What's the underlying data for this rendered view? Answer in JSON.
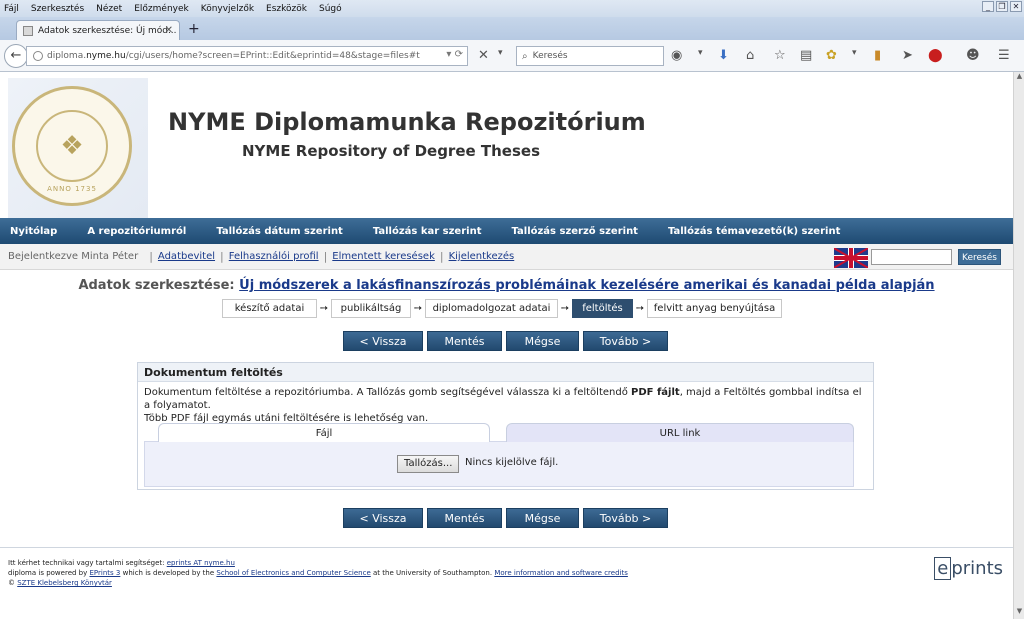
{
  "browser": {
    "menu": [
      "Fájl",
      "Szerkesztés",
      "Nézet",
      "Előzmények",
      "Könyvjelzők",
      "Eszközök",
      "Súgó"
    ],
    "tab_title": "Adatok szerkesztése: Új mód...",
    "url_prefix": "diploma.",
    "url_host": "nyme.hu",
    "url_rest": "/cgi/users/home?screen=EPrint::Edit&eprintid=48&stage=files#t",
    "search_placeholder": "Keresés"
  },
  "site": {
    "title": "NYME Diplomamunka Repozitórium",
    "subtitle": "NYME Repository of Degree Theses",
    "seal_text": "ANNO 1735"
  },
  "main_nav": [
    "Nyitólap",
    "A repozitóriumról",
    "Tallózás dátum szerint",
    "Tallózás kar szerint",
    "Tallózás szerző szerint",
    "Tallózás témavezető(k) szerint"
  ],
  "user_nav": {
    "logged_in": "Bejelentkezve Minta Péter",
    "links": [
      "Adatbevitel",
      "Felhasználói profil",
      "Elmentett keresések",
      "Kijelentkezés"
    ],
    "search_button": "Keresés"
  },
  "edit": {
    "label": "Adatok szerkesztése:",
    "item_title": "Új módszerek a lakásfinanszírozás problémáinak kezelésére amerikai és kanadai példa alapján"
  },
  "stages": [
    "készítő adatai",
    "publikáltság",
    "diplomadolgozat adatai",
    "feltöltés",
    "felvitt anyag benyújtása"
  ],
  "active_stage": "feltöltés",
  "buttons": {
    "back": "< Vissza",
    "save": "Mentés",
    "cancel": "Mégse",
    "next": "Tovább >"
  },
  "upload": {
    "heading": "Dokumentum feltöltés",
    "text_before": "Dokumentum feltöltése a repozitóriumba. A Tallózás gomb segítségével válassza ki a feltöltendő ",
    "text_bold": "PDF fájlt",
    "text_after": ", majd a Feltöltés gombbal indítsa el a folyamatot.",
    "text_line2": "Több PDF fájl egymás utáni feltöltésére is lehetőség van.",
    "tab_file": "Fájl",
    "tab_url": "URL link",
    "browse_button": "Tallózás...",
    "no_file": "Nincs kijelölve fájl."
  },
  "footer": {
    "help_text": "Itt kérhet technikai vagy tartalmi segítséget:",
    "help_email": "eprints AT nyme.hu",
    "powered_prefix": "diploma is powered by",
    "eprints_link": "EPrints 3",
    "powered_middle": "which is developed by the",
    "school_link": "School of Electronics and Computer Science",
    "powered_suffix": "at the University of Southampton.",
    "credits_link": "More information and software credits",
    "copyright_sym": "©",
    "library_link": "SZTE Klebelsberg Könyvtár",
    "eprints_logo": "prints",
    "eprints_logo_e": "e"
  }
}
